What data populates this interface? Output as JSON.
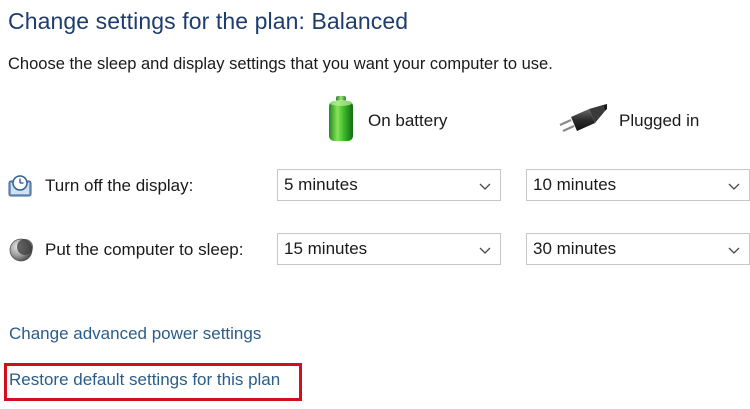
{
  "header": {
    "title": "Change settings for the plan: Balanced",
    "subtitle": "Choose the sleep and display settings that you want your computer to use."
  },
  "columns": {
    "battery": {
      "label": "On battery",
      "icon": "battery-icon"
    },
    "plugged": {
      "label": "Plugged in",
      "icon": "power-plug-icon"
    }
  },
  "rows": [
    {
      "label": "Turn off the display:",
      "icon": "display-timer-icon",
      "battery_value": "5 minutes",
      "plugged_value": "10 minutes"
    },
    {
      "label": "Put the computer to sleep:",
      "icon": "sleep-moon-icon",
      "battery_value": "15 minutes",
      "plugged_value": "30 minutes"
    }
  ],
  "links": {
    "advanced": "Change advanced power settings",
    "restore": "Restore default settings for this plan"
  },
  "colors": {
    "title": "#1e3c6f",
    "link": "#2a5d8a",
    "highlight": "#d0101a",
    "dropdown_border": "#c7c7c7"
  }
}
